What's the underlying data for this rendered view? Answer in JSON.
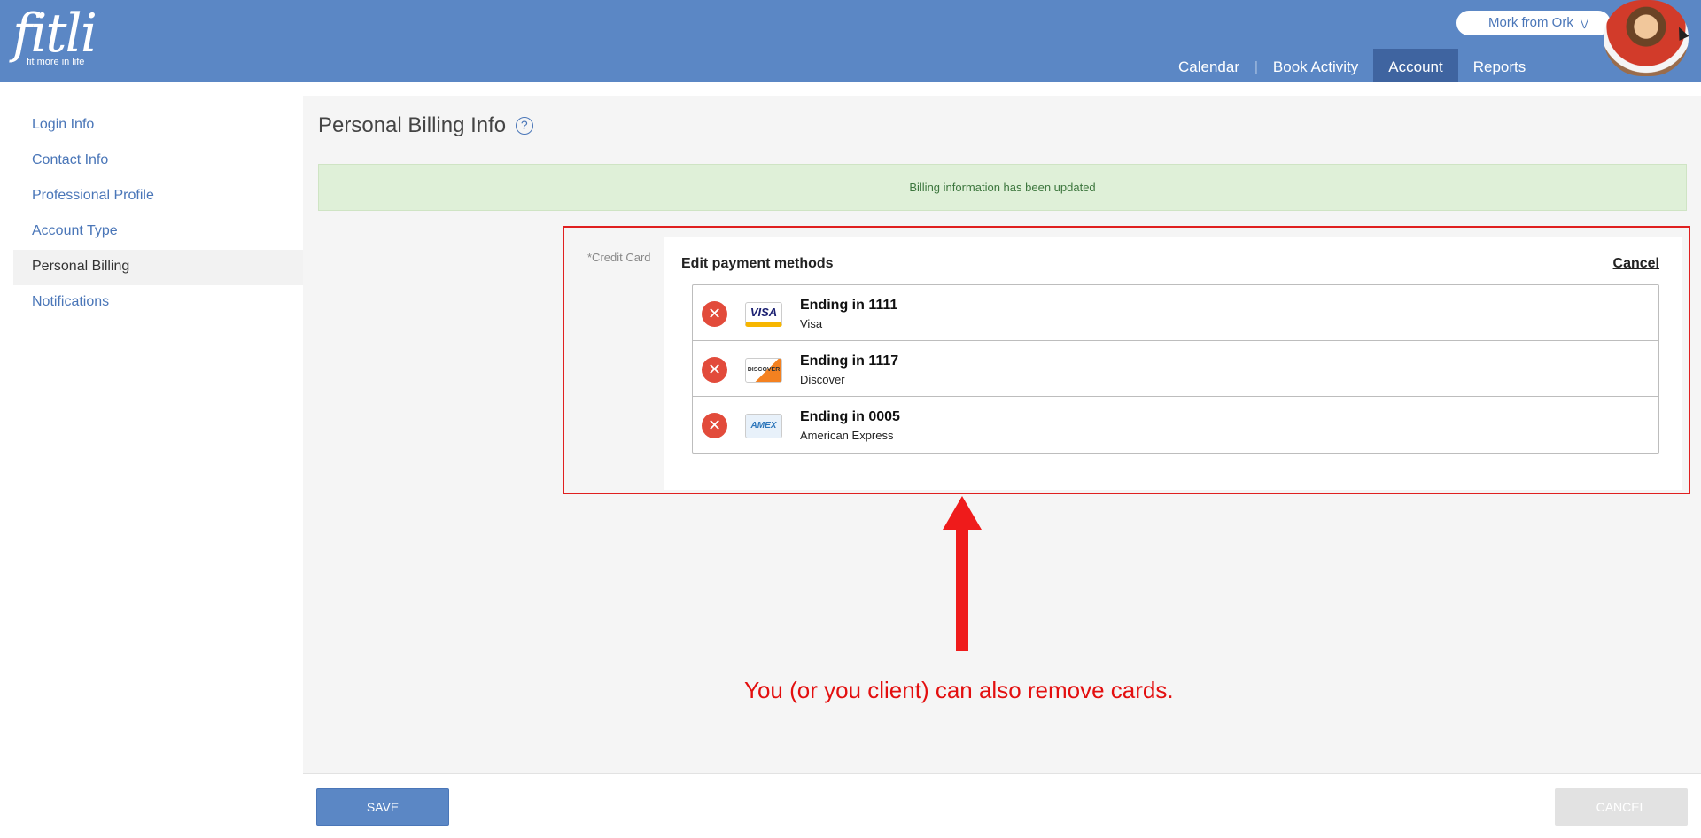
{
  "header": {
    "logo_text": "fitli",
    "logo_tagline": "fit more in life",
    "user_name": "Mork from Ork",
    "nav": [
      "Calendar",
      "Book Activity",
      "Account",
      "Reports"
    ],
    "active_nav": "Account",
    "accent_color": "#5b87c5"
  },
  "sidebar": {
    "items": [
      "Login Info",
      "Contact Info",
      "Professional Profile",
      "Account Type",
      "Personal Billing",
      "Notifications"
    ],
    "active_item": "Personal Billing"
  },
  "main": {
    "title": "Personal Billing Info",
    "help_icon": "?",
    "alert_text": "Billing information has been updated",
    "credit_card_label": "*Credit Card",
    "payment_panel": {
      "title": "Edit payment methods",
      "cancel_label": "Cancel",
      "cards": [
        {
          "title": "Ending in 1111",
          "brand": "Visa",
          "logo_text": "VISA"
        },
        {
          "title": "Ending in 1117",
          "brand": "Discover",
          "logo_text": "DISCOVER"
        },
        {
          "title": "Ending in 0005",
          "brand": "American Express",
          "logo_text": "AMEX"
        }
      ]
    }
  },
  "annotation": {
    "text": "You (or you client) can also remove cards.",
    "color": "#e30f0f"
  },
  "footer": {
    "save_label": "SAVE",
    "cancel_label": "CANCEL"
  }
}
